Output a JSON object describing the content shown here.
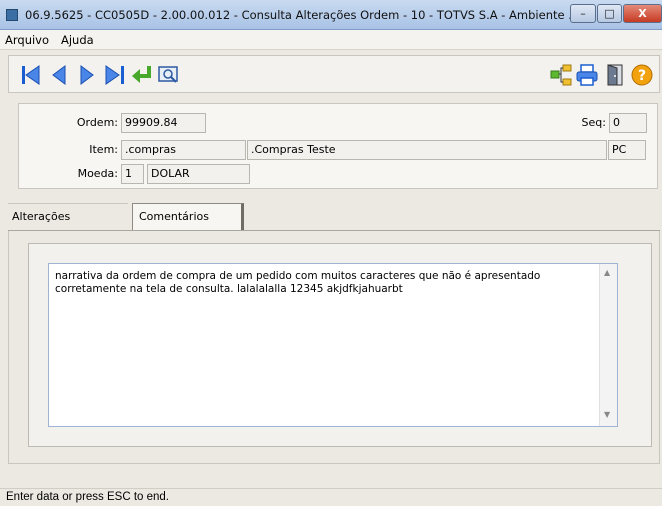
{
  "window": {
    "title": "06.9.5625 - CC0505D - 2.00.00.012 - Consulta Alterações Ordem - 10 - TOTVS S.A - Ambiente ..."
  },
  "menu": {
    "items": [
      "Arquivo",
      "Ajuda"
    ]
  },
  "toolbar": {
    "left_icons": [
      "first-record-icon",
      "previous-record-icon",
      "next-record-icon",
      "last-record-icon",
      "return-icon",
      "search-icon"
    ],
    "right_icons": [
      "tree-icon",
      "print-icon",
      "exit-door-icon",
      "help-icon"
    ],
    "accent": "#1a5fd1"
  },
  "form": {
    "ordem_label": "Ordem:",
    "ordem_value": "99909.84",
    "seq_label": "Seq:",
    "seq_value": "0",
    "item_label": "Item:",
    "item_code": ".compras",
    "item_desc": ".Compras Teste",
    "item_unit": "PC",
    "moeda_label": "Moeda:",
    "moeda_code": "1",
    "moeda_name": "DOLAR"
  },
  "tabs": [
    {
      "label": "Alterações"
    },
    {
      "label": "Comentários"
    }
  ],
  "comment": {
    "text": "narrativa da ordem de compra de um pedido com muitos caracteres que não é apresentado corretamente na tela de consulta. lalalalalla 12345 akjdfkjahuarbt"
  },
  "status": {
    "text": "Enter data or press ESC to end."
  }
}
